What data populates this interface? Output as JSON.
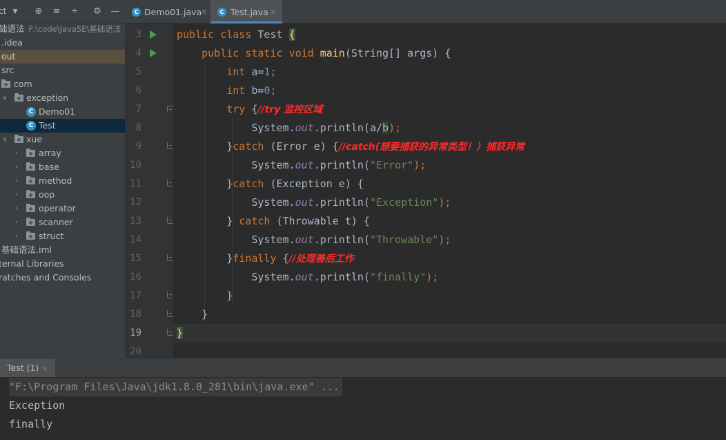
{
  "project_panel": {
    "title": "ct",
    "toolbar_icons": [
      "chevron-down-icon",
      "locate-icon",
      "expand-all-icon",
      "collapse-all-icon",
      "gear-icon",
      "minimize-icon"
    ],
    "root_name": "础语法",
    "root_path": "F:\\code\\JavaSE\\基础语法",
    "items": [
      {
        "label": ".idea"
      },
      {
        "label": "out"
      },
      {
        "label": "src"
      },
      {
        "label": "com"
      },
      {
        "label": "exception"
      },
      {
        "label": "Demo01"
      },
      {
        "label": "Test"
      },
      {
        "label": "xue"
      },
      {
        "label": "array"
      },
      {
        "label": "base"
      },
      {
        "label": "method"
      },
      {
        "label": "oop"
      },
      {
        "label": "operator"
      },
      {
        "label": "scanner"
      },
      {
        "label": "struct"
      },
      {
        "label": "基础语法.iml"
      },
      {
        "label": "ternal Libraries"
      },
      {
        "label": "ratches and Consoles"
      }
    ]
  },
  "tabs": [
    {
      "label": "Demo01.java",
      "active": false
    },
    {
      "label": "Test.java",
      "active": true
    }
  ],
  "editor": {
    "line_numbers": [
      "3",
      "4",
      "5",
      "6",
      "7",
      "8",
      "9",
      "10",
      "11",
      "12",
      "13",
      "14",
      "15",
      "16",
      "17",
      "18",
      "19",
      "20"
    ],
    "current_line": "19",
    "code": {
      "l3_a": "public class ",
      "l3_b": "Test ",
      "l3_c": "{",
      "l4_a": "public static void ",
      "l4_b": "main",
      "l4_c": "(String[] args) {",
      "l5_a": "int ",
      "l5_b": "a=",
      "l5_c": "1",
      "l5_d": ";",
      "l6_a": "int ",
      "l6_b": "b=",
      "l6_c": "0",
      "l6_d": ";",
      "l7_a": "try ",
      "l7_b": "{",
      "l7_c": "//try 监控区域",
      "l8_a": "System.",
      "l8_b": "out",
      "l8_c": ".println(a/",
      "l8_d": "b",
      "l8_e": ");",
      "l9_a": "}",
      "l9_b": "catch ",
      "l9_c": "(Error e) {",
      "l9_d": "//catch(想要捕获的异常类型！）捕获异常",
      "l10_a": "System.",
      "l10_b": "out",
      "l10_c": ".println(",
      "l10_d": "\"Error\"",
      "l10_e": ");",
      "l11_a": "}",
      "l11_b": "catch ",
      "l11_c": "(Exception e) {",
      "l12_a": "System.",
      "l12_b": "out",
      "l12_c": ".println(",
      "l12_d": "\"Exception\"",
      "l12_e": ");",
      "l13_a": "} ",
      "l13_b": "catch ",
      "l13_c": "(Throwable t) {",
      "l14_a": "System.",
      "l14_b": "out",
      "l14_c": ".println(",
      "l14_d": "\"Throwable\"",
      "l14_e": ");",
      "l15_a": "}",
      "l15_b": "finally ",
      "l15_c": "{",
      "l15_d": "//处理善后工作",
      "l16_a": "System.",
      "l16_b": "out",
      "l16_c": ".println(",
      "l16_d": "\"finally\"",
      "l16_e": ");",
      "l17_a": "}",
      "l18_a": "}",
      "l19_a": "}"
    }
  },
  "run_panel": {
    "tab_label": "Test (1)",
    "close_glyph": "×",
    "console_lines": [
      "\"F:\\Program Files\\Java\\jdk1.8.0_281\\bin\\java.exe\" ...",
      "Exception",
      "finally"
    ]
  },
  "colors": {
    "keyword": "#cc7832",
    "string": "#6a8759",
    "number": "#6897bb",
    "static_field": "#9876aa",
    "method_decl": "#ffc66d",
    "comment": "#ff2b2b",
    "run_icon": "#499c54",
    "class_icon": "#3592c4"
  }
}
